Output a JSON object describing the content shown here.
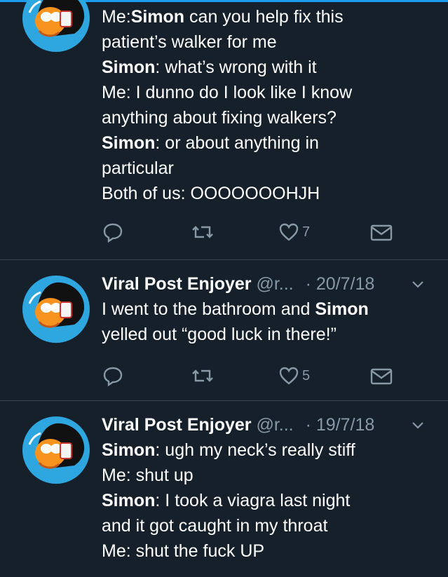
{
  "tweets": [
    {
      "name": "",
      "handle": "",
      "date": "",
      "lines": [
        {
          "bold": "Me:",
          "rest": " "
        },
        {
          "bold": "",
          "rest": "patient’s walker for me"
        },
        {
          "bold": "Simon",
          "rest": ": what’s wrong with it"
        },
        {
          "bold": "",
          "rest": "Me: I dunno do I look like I know"
        },
        {
          "bold": "",
          "rest": "anything about fixing walkers?"
        },
        {
          "bold": "Simon",
          "rest": ": or about anything in"
        },
        {
          "bold": "",
          "rest": "particular"
        },
        {
          "bold": "",
          "rest": "Both of us: OOOOOOOHJH"
        }
      ],
      "line0_simon": "Simon",
      "line0_tail": " can you help fix this",
      "likes": "7"
    },
    {
      "name": "Viral Post Enjoyer",
      "handle": "@r...",
      "date": "· 20/7/18",
      "lines": [
        {
          "pre": "I went to the bathroom and ",
          "bold": "Simon",
          "rest": ""
        },
        {
          "pre": "yelled out “good luck in there!”",
          "bold": "",
          "rest": ""
        }
      ],
      "likes": "5"
    },
    {
      "name": "Viral Post Enjoyer",
      "handle": "@r...",
      "date": "· 19/7/18",
      "lines": [
        {
          "bold": "Simon",
          "rest": ": ugh my neck’s really stiff"
        },
        {
          "bold": "",
          "rest": "Me: shut up"
        },
        {
          "bold": "Simon",
          "rest": ": I took a viagra last night"
        },
        {
          "bold": "",
          "rest": "and it got caught in my throat"
        },
        {
          "bold": "",
          "rest": "Me: shut the fuck UP"
        }
      ]
    }
  ],
  "icons": {
    "reply": "reply-icon",
    "retweet": "retweet-icon",
    "like": "heart-icon",
    "dm": "envelope-icon",
    "caret": "chevron-down-icon"
  },
  "colors": {
    "background": "#15202b",
    "secondary_text": "#8899a6",
    "divider": "#38444d",
    "avatar_bg": "#2ea6df"
  }
}
